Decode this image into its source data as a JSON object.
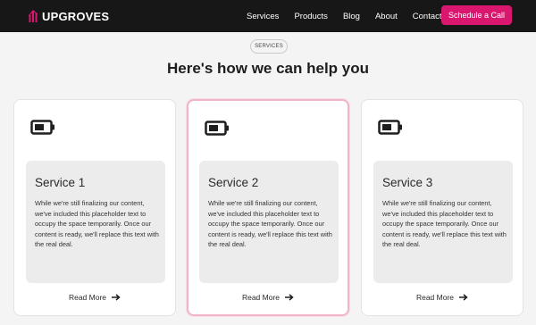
{
  "brand": {
    "name": "UPGROVES",
    "accent": "#d9176e",
    "header_bg": "#171717"
  },
  "nav": {
    "items": [
      {
        "label": "Services"
      },
      {
        "label": "Products"
      },
      {
        "label": "Blog"
      },
      {
        "label": "About"
      },
      {
        "label": "Contact"
      }
    ],
    "cta_label": "Schedule a Call"
  },
  "section": {
    "pill": "SERVICES",
    "title": "Here's how we can help you"
  },
  "cards": [
    {
      "icon": "battery-icon",
      "title": "Service 1",
      "text": "While we're still finalizing our content, we've included this placeholder text to occupy the space temporarily. Once our content is ready, we'll replace this text with the real deal.",
      "link": "Read More"
    },
    {
      "icon": "battery-icon",
      "title": "Service 2",
      "text": "While we're still finalizing our content, we've included this placeholder text to occupy the space temporarily. Once our content is ready, we'll replace this text with the real deal.",
      "link": "Read More"
    },
    {
      "icon": "battery-icon",
      "title": "Service 3",
      "text": "While we're still finalizing our content, we've included this placeholder text to occupy the space temporarily. Once our content is ready, we'll replace this text with the real deal.",
      "link": "Read More"
    }
  ]
}
